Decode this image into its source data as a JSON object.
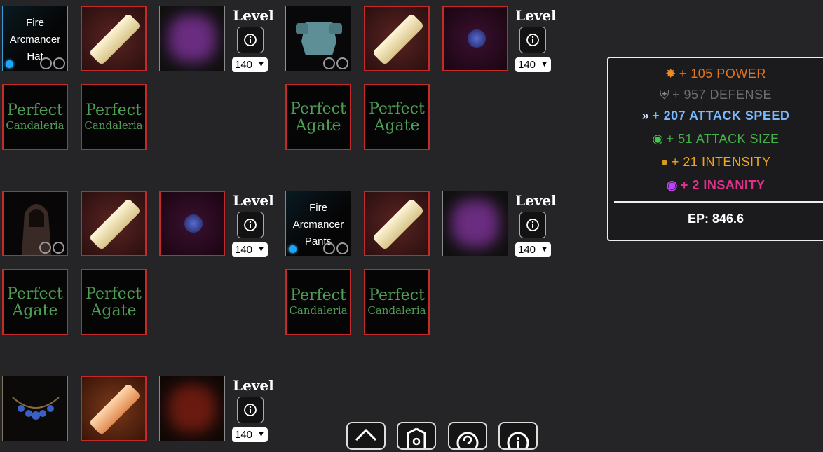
{
  "gear": {
    "hat": {
      "name": "Fire Arcmancer Hat"
    },
    "pants": {
      "name": "Fire Arcmancer Pants"
    }
  },
  "gems": {
    "candaleria": {
      "line1": "Perfect",
      "line2": "Candaleria"
    },
    "agate": {
      "line1": "Perfect",
      "line2": "Agate"
    }
  },
  "level": {
    "label": "Level",
    "value": "140"
  },
  "stats": {
    "power": "+ 105 POWER",
    "defense": "+ 957 DEFENSE",
    "attack_speed": "+ 207 ATTACK SPEED",
    "attack_size": "+ 51 ATTACK SIZE",
    "intensity": "+ 21 INTENSITY",
    "insanity": "+ 2 INSANITY",
    "ep": "EP: 846.6",
    "colors": {
      "power": "#e0741f",
      "defense": "#6d6d6d",
      "attack_speed": "#5aa8ff",
      "attack_size": "#43b14a",
      "intensity": "#f0a51c",
      "insanity": "#e0308a"
    }
  },
  "nav": [
    "home-icon",
    "shield-icon",
    "help-icon",
    "info-icon"
  ]
}
